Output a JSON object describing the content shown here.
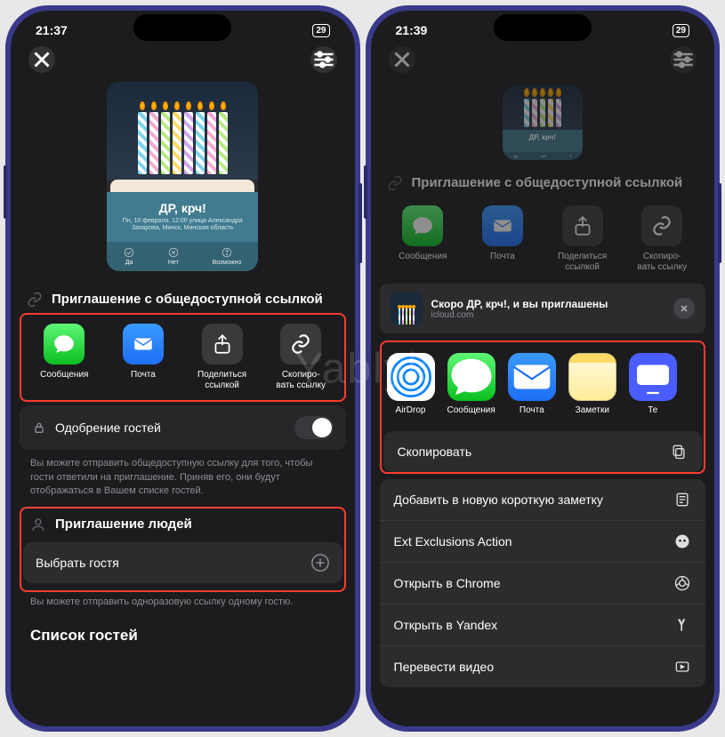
{
  "watermark": "Yablyk",
  "phone1": {
    "status": {
      "time": "21:37",
      "battery": "29"
    },
    "preview": {
      "title": "ДР, крч!",
      "subtitle": "Пн, 10 февраля, 12:00\nулица Александра Захарова, Минск, Минская область",
      "btn1": "Да",
      "btn2": "Нет",
      "btn3": "Возможно"
    },
    "invite_section_title": "Приглашение с общедоступной ссылкой",
    "share": {
      "messages": "Сообщения",
      "mail": "Почта",
      "share_link": "Поделиться ссылкой",
      "copy_link": "Скопиро-\nвать ссылку"
    },
    "approval": {
      "label": "Одобрение гостей"
    },
    "hint1": "Вы можете отправить общедоступную ссылку для того, чтобы гости ответили на приглашение. Приняв его, они будут отображаться в Вашем списке гостей.",
    "people_section": "Приглашение людей",
    "select_guest": "Выбрать гостя",
    "hint2": "Вы можете отправить одноразовую ссылку одному гостю.",
    "guest_list": "Список гостей"
  },
  "phone2": {
    "status": {
      "time": "21:39",
      "battery": "29"
    },
    "preview": {
      "title": "ДР, крч!"
    },
    "invite_section_title": "Приглашение с общедоступной ссылкой",
    "share": {
      "messages": "Сообщения",
      "mail": "Почта",
      "share_link": "Поделиться ссылкой",
      "copy_link": "Скопиро-\nвать ссылку"
    },
    "sheet_header": {
      "title": "Скоро ДР, крч!, и вы приглашены",
      "subtitle": "icloud.com"
    },
    "apps": {
      "airdrop": "AirDrop",
      "messages": "Сообщения",
      "mail": "Почта",
      "notes": "Заметки",
      "tv": "Те"
    },
    "actions": {
      "copy": "Скопировать",
      "quick_note": "Добавить в новую короткую заметку",
      "ext": "Ext Exclusions Action",
      "chrome": "Открыть в Chrome",
      "yandex": "Открыть в Yandex",
      "translate": "Перевести видео"
    }
  }
}
